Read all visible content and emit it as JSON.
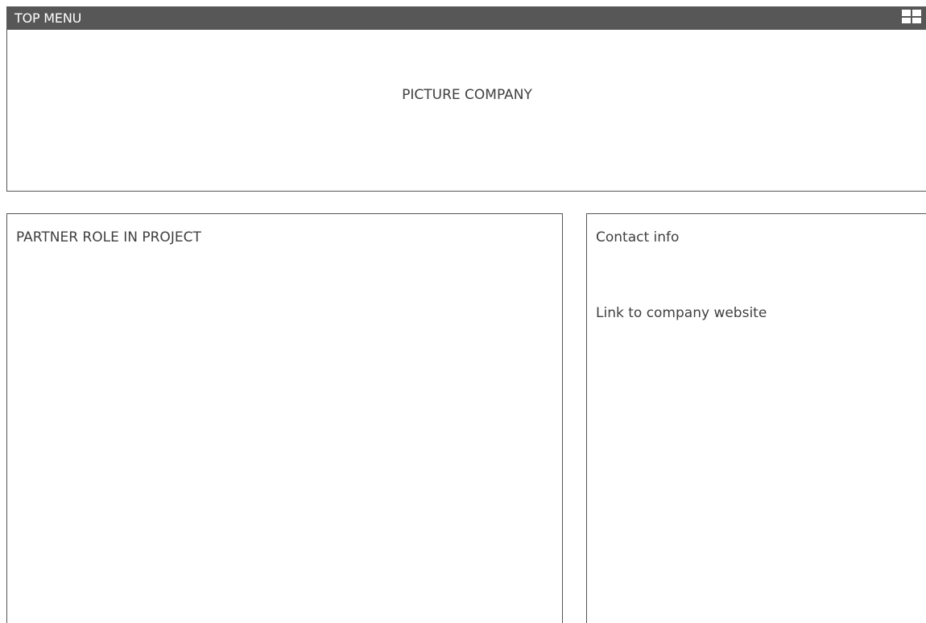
{
  "top_menu": {
    "label": "TOP MENU",
    "menu_icon": "grid-icon"
  },
  "hero": {
    "label": "PICTURE COMPANY"
  },
  "partner_panel": {
    "title": "PARTNER ROLE IN PROJECT"
  },
  "contact_panel": {
    "title": "Contact info",
    "website_link": "Link to company website"
  },
  "colors": {
    "menu_bar": "#575757",
    "border": "#555555",
    "text": "#3f3f3f",
    "background": "#ffffff"
  }
}
